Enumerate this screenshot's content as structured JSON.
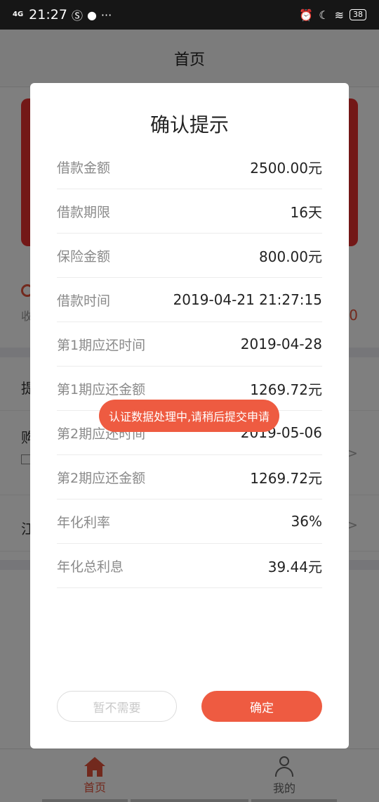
{
  "status_bar": {
    "network": "4G",
    "time": "21:27",
    "icons": [
      "s-box-icon",
      "planet-icon",
      "more-dots-icon",
      "alarm-icon",
      "moon-icon",
      "wifi-icon"
    ],
    "battery": "38"
  },
  "header": {
    "title": "首页"
  },
  "background": {
    "income_label": "收",
    "income_value": "0",
    "rows": [
      {
        "label": "提"
      },
      {
        "label": "购"
      },
      {
        "label": "江"
      }
    ]
  },
  "dialog": {
    "title": "确认提示",
    "rows": [
      {
        "label": "借款金额",
        "value": "2500.00元"
      },
      {
        "label": "借款期限",
        "value": "16天"
      },
      {
        "label": "保险金额",
        "value": "800.00元"
      },
      {
        "label": "借款时间",
        "value": "2019-04-21 21:27:15"
      },
      {
        "label": "第1期应还时间",
        "value": "2019-04-28"
      },
      {
        "label": "第1期应还金额",
        "value": "1269.72元"
      },
      {
        "label": "第2期应还时间",
        "value": "2019-05-06"
      },
      {
        "label": "第2期应还金额",
        "value": "1269.72元"
      },
      {
        "label": "年化利率",
        "value": "36%"
      },
      {
        "label": "年化总利息",
        "value": "39.44元"
      }
    ],
    "cancel_label": "暂不需要",
    "confirm_label": "确定"
  },
  "toast": {
    "message": "认证数据处理中,请稍后提交申请"
  },
  "tabbar": {
    "tabs": [
      {
        "label": "首页",
        "icon": "home-icon",
        "active": true
      },
      {
        "label": "我的",
        "icon": "user-icon",
        "active": false
      }
    ]
  },
  "colors": {
    "accent": "#ee5b41",
    "card_red": "#e7302e",
    "overlay": "rgba(0,0,0,0.5)"
  }
}
